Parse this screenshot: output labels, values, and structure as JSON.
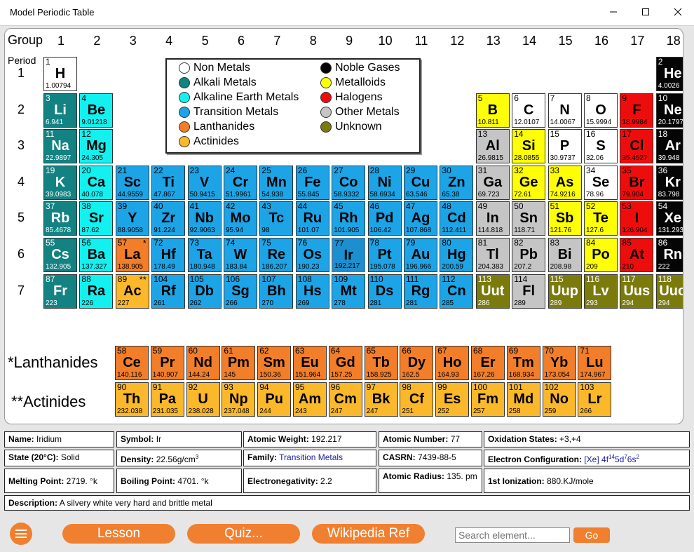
{
  "window": {
    "title": "Model Periodic Table"
  },
  "colors": {
    "nonmetal": "#ffffff",
    "alkali": "#138282",
    "alkaline": "#12f0f0",
    "transition": "#1da4e6",
    "lanthanide": "#f27e2a",
    "actinide": "#fbb82a",
    "noble": "#050505",
    "metalloid": "#fefe06",
    "halogen": "#ee0d0d",
    "other": "#c5c5c5",
    "unknown": "#7b7b0d",
    "accent": "#f08030"
  },
  "table": {
    "group_label": "Group",
    "period_label": "Period",
    "groups": [
      "1",
      "2",
      "3",
      "4",
      "5",
      "6",
      "7",
      "8",
      "9",
      "10",
      "11",
      "12",
      "13",
      "14",
      "15",
      "16",
      "17",
      "18"
    ],
    "periods": [
      "1",
      "2",
      "3",
      "4",
      "5",
      "6",
      "7"
    ],
    "lanthanides_label": "*Lanthanides",
    "actinides_label": "**Actinides",
    "selected": "Ir"
  },
  "legend": [
    {
      "label": "Non Metals",
      "cat": "nonmetal"
    },
    {
      "label": "Alkali Metals",
      "cat": "alkali"
    },
    {
      "label": "Alkaline Earth Metals",
      "cat": "alkaline"
    },
    {
      "label": "Transition Metals",
      "cat": "transition"
    },
    {
      "label": "Lanthanides",
      "cat": "lanthanide"
    },
    {
      "label": "Actinides",
      "cat": "actinide"
    },
    {
      "label": "Noble Gases",
      "cat": "noble"
    },
    {
      "label": "Metalloids",
      "cat": "metalloid"
    },
    {
      "label": "Halogens",
      "cat": "halogen"
    },
    {
      "label": "Other Metals",
      "cat": "other"
    },
    {
      "label": "Unknown",
      "cat": "unknown"
    }
  ],
  "elements": [
    {
      "n": "1",
      "s": "H",
      "w": "1.00794",
      "c": "nonmetal",
      "g": 1,
      "p": 1
    },
    {
      "n": "2",
      "s": "He",
      "w": "4.0026",
      "c": "noble",
      "g": 18,
      "p": 1
    },
    {
      "n": "3",
      "s": "Li",
      "w": "6.941",
      "c": "alkali",
      "g": 1,
      "p": 2
    },
    {
      "n": "4",
      "s": "Be",
      "w": "9.01218",
      "c": "alkaline",
      "g": 2,
      "p": 2
    },
    {
      "n": "5",
      "s": "B",
      "w": "10.811",
      "c": "metalloid",
      "g": 13,
      "p": 2
    },
    {
      "n": "6",
      "s": "C",
      "w": "12.0107",
      "c": "nonmetal",
      "g": 14,
      "p": 2
    },
    {
      "n": "7",
      "s": "N",
      "w": "14.0067",
      "c": "nonmetal",
      "g": 15,
      "p": 2
    },
    {
      "n": "8",
      "s": "O",
      "w": "15.9994",
      "c": "nonmetal",
      "g": 16,
      "p": 2
    },
    {
      "n": "9",
      "s": "F",
      "w": "18.9984",
      "c": "halogen",
      "g": 17,
      "p": 2
    },
    {
      "n": "10",
      "s": "Ne",
      "w": "20.1797",
      "c": "noble",
      "g": 18,
      "p": 2
    },
    {
      "n": "11",
      "s": "Na",
      "w": "22.9897",
      "c": "alkali",
      "g": 1,
      "p": 3
    },
    {
      "n": "12",
      "s": "Mg",
      "w": "24.305",
      "c": "alkaline",
      "g": 2,
      "p": 3
    },
    {
      "n": "13",
      "s": "Al",
      "w": "26.9815",
      "c": "other",
      "g": 13,
      "p": 3
    },
    {
      "n": "14",
      "s": "Si",
      "w": "28.0855",
      "c": "metalloid",
      "g": 14,
      "p": 3
    },
    {
      "n": "15",
      "s": "P",
      "w": "30.9737",
      "c": "nonmetal",
      "g": 15,
      "p": 3
    },
    {
      "n": "16",
      "s": "S",
      "w": "32.06",
      "c": "nonmetal",
      "g": 16,
      "p": 3
    },
    {
      "n": "17",
      "s": "Cl",
      "w": "35.4527",
      "c": "halogen",
      "g": 17,
      "p": 3
    },
    {
      "n": "18",
      "s": "Ar",
      "w": "39.948",
      "c": "noble",
      "g": 18,
      "p": 3
    },
    {
      "n": "19",
      "s": "K",
      "w": "39.0983",
      "c": "alkali",
      "g": 1,
      "p": 4
    },
    {
      "n": "20",
      "s": "Ca",
      "w": "40.078",
      "c": "alkaline",
      "g": 2,
      "p": 4
    },
    {
      "n": "21",
      "s": "Sc",
      "w": "44.9559",
      "c": "transition",
      "g": 3,
      "p": 4
    },
    {
      "n": "22",
      "s": "Ti",
      "w": "47.867",
      "c": "transition",
      "g": 4,
      "p": 4
    },
    {
      "n": "23",
      "s": "V",
      "w": "50.9415",
      "c": "transition",
      "g": 5,
      "p": 4
    },
    {
      "n": "24",
      "s": "Cr",
      "w": "51.9961",
      "c": "transition",
      "g": 6,
      "p": 4
    },
    {
      "n": "25",
      "s": "Mn",
      "w": "54.938",
      "c": "transition",
      "g": 7,
      "p": 4
    },
    {
      "n": "26",
      "s": "Fe",
      "w": "55.845",
      "c": "transition",
      "g": 8,
      "p": 4
    },
    {
      "n": "27",
      "s": "Co",
      "w": "58.9332",
      "c": "transition",
      "g": 9,
      "p": 4
    },
    {
      "n": "28",
      "s": "Ni",
      "w": "58.6934",
      "c": "transition",
      "g": 10,
      "p": 4
    },
    {
      "n": "29",
      "s": "Cu",
      "w": "63.546",
      "c": "transition",
      "g": 11,
      "p": 4
    },
    {
      "n": "30",
      "s": "Zn",
      "w": "65.38",
      "c": "transition",
      "g": 12,
      "p": 4
    },
    {
      "n": "31",
      "s": "Ga",
      "w": "69.723",
      "c": "other",
      "g": 13,
      "p": 4
    },
    {
      "n": "32",
      "s": "Ge",
      "w": "72.61",
      "c": "metalloid",
      "g": 14,
      "p": 4
    },
    {
      "n": "33",
      "s": "As",
      "w": "74.9216",
      "c": "metalloid",
      "g": 15,
      "p": 4
    },
    {
      "n": "34",
      "s": "Se",
      "w": "78.96",
      "c": "nonmetal",
      "g": 16,
      "p": 4
    },
    {
      "n": "35",
      "s": "Br",
      "w": "79.904",
      "c": "halogen",
      "g": 17,
      "p": 4
    },
    {
      "n": "36",
      "s": "Kr",
      "w": "83.798",
      "c": "noble",
      "g": 18,
      "p": 4
    },
    {
      "n": "37",
      "s": "Rb",
      "w": "85.4678",
      "c": "alkali",
      "g": 1,
      "p": 5
    },
    {
      "n": "38",
      "s": "Sr",
      "w": "87.62",
      "c": "alkaline",
      "g": 2,
      "p": 5
    },
    {
      "n": "39",
      "s": "Y",
      "w": "88.9058",
      "c": "transition",
      "g": 3,
      "p": 5
    },
    {
      "n": "40",
      "s": "Zr",
      "w": "91.224",
      "c": "transition",
      "g": 4,
      "p": 5
    },
    {
      "n": "41",
      "s": "Nb",
      "w": "92.9063",
      "c": "transition",
      "g": 5,
      "p": 5
    },
    {
      "n": "42",
      "s": "Mo",
      "w": "95.94",
      "c": "transition",
      "g": 6,
      "p": 5
    },
    {
      "n": "43",
      "s": "Tc",
      "w": "98",
      "c": "transition",
      "g": 7,
      "p": 5
    },
    {
      "n": "44",
      "s": "Ru",
      "w": "101.07",
      "c": "transition",
      "g": 8,
      "p": 5
    },
    {
      "n": "45",
      "s": "Rh",
      "w": "101.905",
      "c": "transition",
      "g": 9,
      "p": 5
    },
    {
      "n": "46",
      "s": "Pd",
      "w": "106.42",
      "c": "transition",
      "g": 10,
      "p": 5
    },
    {
      "n": "47",
      "s": "Ag",
      "w": "107.868",
      "c": "transition",
      "g": 11,
      "p": 5
    },
    {
      "n": "48",
      "s": "Cd",
      "w": "112.411",
      "c": "transition",
      "g": 12,
      "p": 5
    },
    {
      "n": "49",
      "s": "In",
      "w": "114.818",
      "c": "other",
      "g": 13,
      "p": 5
    },
    {
      "n": "50",
      "s": "Sn",
      "w": "118.71",
      "c": "other",
      "g": 14,
      "p": 5
    },
    {
      "n": "51",
      "s": "Sb",
      "w": "121.76",
      "c": "metalloid",
      "g": 15,
      "p": 5
    },
    {
      "n": "52",
      "s": "Te",
      "w": "127.6",
      "c": "metalloid",
      "g": 16,
      "p": 5
    },
    {
      "n": "53",
      "s": "I",
      "w": "126.904",
      "c": "halogen",
      "g": 17,
      "p": 5
    },
    {
      "n": "54",
      "s": "Xe",
      "w": "131.293",
      "c": "noble",
      "g": 18,
      "p": 5
    },
    {
      "n": "55",
      "s": "Cs",
      "w": "132.905",
      "c": "alkali",
      "g": 1,
      "p": 6
    },
    {
      "n": "56",
      "s": "Ba",
      "w": "137.327",
      "c": "alkaline",
      "g": 2,
      "p": 6
    },
    {
      "n": "57",
      "s": "La",
      "w": "138.905",
      "c": "lanthanide",
      "g": 3,
      "p": 6,
      "m": "*"
    },
    {
      "n": "72",
      "s": "Hf",
      "w": "178.49",
      "c": "transition",
      "g": 4,
      "p": 6
    },
    {
      "n": "73",
      "s": "Ta",
      "w": "180.948",
      "c": "transition",
      "g": 5,
      "p": 6
    },
    {
      "n": "74",
      "s": "W",
      "w": "183.84",
      "c": "transition",
      "g": 6,
      "p": 6
    },
    {
      "n": "75",
      "s": "Re",
      "w": "186.207",
      "c": "transition",
      "g": 7,
      "p": 6
    },
    {
      "n": "76",
      "s": "Os",
      "w": "190.23",
      "c": "transition",
      "g": 8,
      "p": 6
    },
    {
      "n": "77",
      "s": "Ir",
      "w": "192.217",
      "c": "transition",
      "g": 9,
      "p": 6
    },
    {
      "n": "78",
      "s": "Pt",
      "w": "195.078",
      "c": "transition",
      "g": 10,
      "p": 6
    },
    {
      "n": "79",
      "s": "Au",
      "w": "196.966",
      "c": "transition",
      "g": 11,
      "p": 6
    },
    {
      "n": "80",
      "s": "Hg",
      "w": "200.59",
      "c": "transition",
      "g": 12,
      "p": 6
    },
    {
      "n": "81",
      "s": "Tl",
      "w": "204.383",
      "c": "other",
      "g": 13,
      "p": 6
    },
    {
      "n": "82",
      "s": "Pb",
      "w": "207.2",
      "c": "other",
      "g": 14,
      "p": 6
    },
    {
      "n": "83",
      "s": "Bi",
      "w": "208.98",
      "c": "other",
      "g": 15,
      "p": 6
    },
    {
      "n": "84",
      "s": "Po",
      "w": "209",
      "c": "metalloid",
      "g": 16,
      "p": 6
    },
    {
      "n": "85",
      "s": "At",
      "w": "210",
      "c": "halogen",
      "g": 17,
      "p": 6
    },
    {
      "n": "86",
      "s": "Rn",
      "w": "222",
      "c": "noble",
      "g": 18,
      "p": 6
    },
    {
      "n": "87",
      "s": "Fr",
      "w": "223",
      "c": "alkali",
      "g": 1,
      "p": 7
    },
    {
      "n": "88",
      "s": "Ra",
      "w": "226",
      "c": "alkaline",
      "g": 2,
      "p": 7
    },
    {
      "n": "89",
      "s": "Ac",
      "w": "227",
      "c": "actinide",
      "g": 3,
      "p": 7,
      "m": "**"
    },
    {
      "n": "104",
      "s": "Rf",
      "w": "261",
      "c": "transition",
      "g": 4,
      "p": 7
    },
    {
      "n": "105",
      "s": "Db",
      "w": "262",
      "c": "transition",
      "g": 5,
      "p": 7
    },
    {
      "n": "106",
      "s": "Sg",
      "w": "266",
      "c": "transition",
      "g": 6,
      "p": 7
    },
    {
      "n": "107",
      "s": "Bh",
      "w": "270",
      "c": "transition",
      "g": 7,
      "p": 7
    },
    {
      "n": "108",
      "s": "Hs",
      "w": "269",
      "c": "transition",
      "g": 8,
      "p": 7
    },
    {
      "n": "109",
      "s": "Mt",
      "w": "278",
      "c": "transition",
      "g": 9,
      "p": 7
    },
    {
      "n": "110",
      "s": "Ds",
      "w": "281",
      "c": "transition",
      "g": 10,
      "p": 7
    },
    {
      "n": "111",
      "s": "Rg",
      "w": "281",
      "c": "transition",
      "g": 11,
      "p": 7
    },
    {
      "n": "112",
      "s": "Cn",
      "w": "285",
      "c": "transition",
      "g": 12,
      "p": 7
    },
    {
      "n": "113",
      "s": "Uut",
      "w": "286",
      "c": "unknown",
      "g": 13,
      "p": 7
    },
    {
      "n": "114",
      "s": "Fl",
      "w": "289",
      "c": "other",
      "g": 14,
      "p": 7
    },
    {
      "n": "115",
      "s": "Uup",
      "w": "289",
      "c": "unknown",
      "g": 15,
      "p": 7
    },
    {
      "n": "116",
      "s": "Lv",
      "w": "293",
      "c": "unknown",
      "g": 16,
      "p": 7
    },
    {
      "n": "117",
      "s": "Uus",
      "w": "294",
      "c": "unknown",
      "g": 17,
      "p": 7
    },
    {
      "n": "118",
      "s": "Uuo",
      "w": "294",
      "c": "unknown",
      "g": 18,
      "p": 7
    }
  ],
  "lanthanides": [
    {
      "n": "58",
      "s": "Ce",
      "w": "140.116"
    },
    {
      "n": "59",
      "s": "Pr",
      "w": "140.907"
    },
    {
      "n": "60",
      "s": "Nd",
      "w": "144.24"
    },
    {
      "n": "61",
      "s": "Pm",
      "w": "145"
    },
    {
      "n": "62",
      "s": "Sm",
      "w": "150.36"
    },
    {
      "n": "63",
      "s": "Eu",
      "w": "151.964"
    },
    {
      "n": "64",
      "s": "Gd",
      "w": "157.25"
    },
    {
      "n": "65",
      "s": "Tb",
      "w": "158.925"
    },
    {
      "n": "66",
      "s": "Dy",
      "w": "162.5"
    },
    {
      "n": "67",
      "s": "Ho",
      "w": "164.93"
    },
    {
      "n": "68",
      "s": "Er",
      "w": "167.26"
    },
    {
      "n": "69",
      "s": "Tm",
      "w": "168.934"
    },
    {
      "n": "70",
      "s": "Yb",
      "w": "173.054"
    },
    {
      "n": "71",
      "s": "Lu",
      "w": "174.967"
    }
  ],
  "actinides": [
    {
      "n": "90",
      "s": "Th",
      "w": "232.038"
    },
    {
      "n": "91",
      "s": "Pa",
      "w": "231.035"
    },
    {
      "n": "92",
      "s": "U",
      "w": "238.028"
    },
    {
      "n": "93",
      "s": "Np",
      "w": "237.048"
    },
    {
      "n": "94",
      "s": "Pu",
      "w": "244"
    },
    {
      "n": "95",
      "s": "Am",
      "w": "243"
    },
    {
      "n": "96",
      "s": "Cm",
      "w": "247"
    },
    {
      "n": "97",
      "s": "Bk",
      "w": "247"
    },
    {
      "n": "98",
      "s": "Cf",
      "w": "251"
    },
    {
      "n": "99",
      "s": "Es",
      "w": "252"
    },
    {
      "n": "100",
      "s": "Fm",
      "w": "257"
    },
    {
      "n": "101",
      "s": "Md",
      "w": "258"
    },
    {
      "n": "102",
      "s": "No",
      "w": "259"
    },
    {
      "n": "103",
      "s": "Lr",
      "w": "266"
    }
  ],
  "info": {
    "name_label": "Name:",
    "name": "Iridium",
    "symbol_label": "Symbol:",
    "symbol": "Ir",
    "weight_label": "Atomic Weight:",
    "weight": "192.217",
    "number_label": "Atomic Number:",
    "number": "77",
    "oxidation_label": "Oxidation States:",
    "oxidation": "+3,+4",
    "state_label": "State (20°C):",
    "state": "Solid",
    "density_label": "Density:",
    "density": "22.56g/cm",
    "density_exp": "3",
    "family_label": "Family:",
    "family": "Transition Metals",
    "casrn_label": "CASRN:",
    "casrn": "7439-88-5",
    "config_label": "Electron Configuration:",
    "config_core": "[Xe]",
    "config_1": "4f",
    "config_1e": "14",
    "config_2": "5d",
    "config_2e": "7",
    "config_3": "6s",
    "config_3e": "2",
    "melting_label": "Melting Point:",
    "melting": "2719. °k",
    "boiling_label": "Boiling Point:",
    "boiling": "4701. °k",
    "electroneg_label": "Electronegativity:",
    "electroneg": "2.2",
    "radius_label": "Atomic Radius:",
    "radius": "135. pm",
    "ionization_label": "1st Ionization:",
    "ionization": "880.KJ/mole",
    "description_label": "Description:",
    "description": "A silvery white very hard and brittle metal"
  },
  "bottom": {
    "lesson": "Lesson",
    "quiz": "Quiz...",
    "wiki": "Wikipedia Ref",
    "search_placeholder": "Search element...",
    "go": "Go"
  }
}
